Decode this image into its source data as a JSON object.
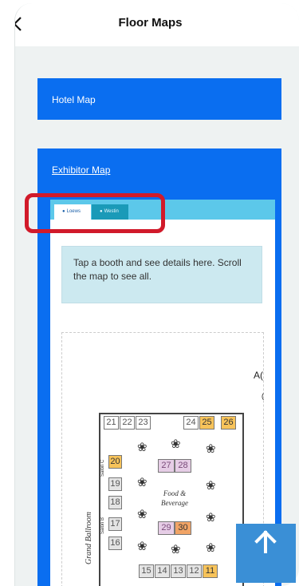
{
  "header": {
    "title": "Floor Maps"
  },
  "hotel_map": {
    "label": "Hotel Map"
  },
  "exhibitor_map": {
    "label": "Exhibitor Map",
    "tabs": [
      {
        "label": "Loews"
      },
      {
        "label": "Westin"
      }
    ],
    "info_text": "Tap a booth and see details here. Scroll the map to see all.",
    "map": {
      "hall_label": "A(",
      "hall_label_2": "(",
      "food_label_1": "Food &",
      "food_label_2": "Beverage",
      "salon_c": "Salon C",
      "salon_b": "Salon B",
      "ballroom": "Grand Ballroom",
      "booths": {
        "b21": "21",
        "b22": "22",
        "b23": "23",
        "b24": "24",
        "b25": "25",
        "b26": "26",
        "b20": "20",
        "b19": "19",
        "b18": "18",
        "b17": "17",
        "b16": "16",
        "b27": "27",
        "b28": "28",
        "b29": "29",
        "b30": "30",
        "b15": "15",
        "b14": "14",
        "b13": "13",
        "b12": "12",
        "b11": "11"
      }
    }
  },
  "colors": {
    "accent": "#0a6ef0",
    "tabbar": "#5cc8ea",
    "highlight": "#d11a2a",
    "scroll_button": "#3a8fd6"
  },
  "icons": {
    "back": "chevron-left-icon",
    "scroll_top": "arrow-up-icon",
    "tab_pin": "map-pin-icon",
    "table": "round-table-icon"
  }
}
